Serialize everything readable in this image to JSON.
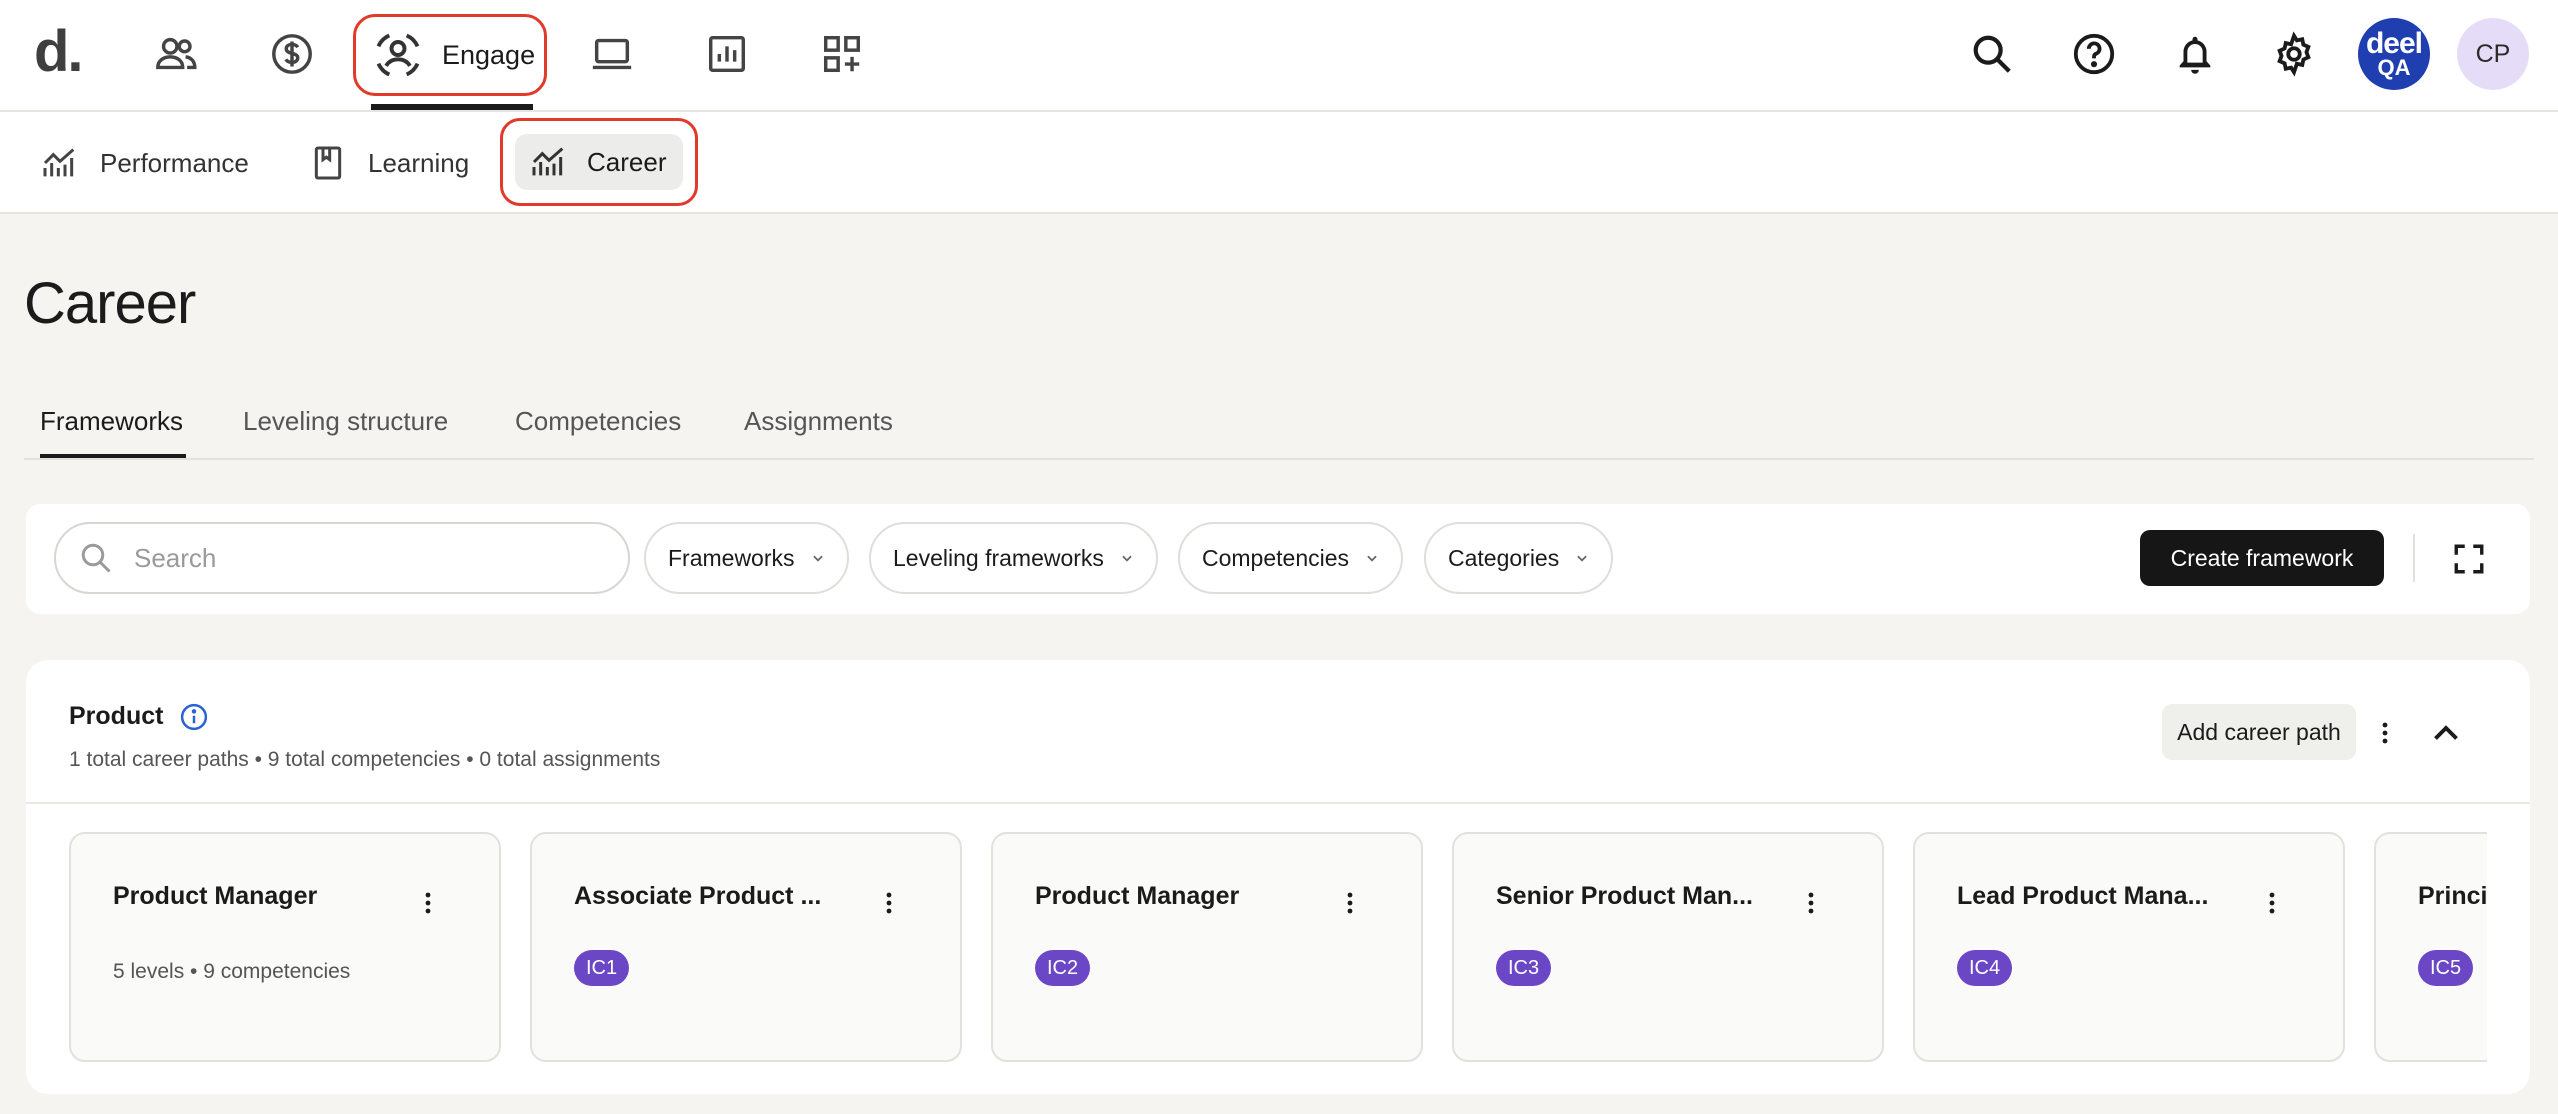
{
  "topnav": {
    "logo": "d.",
    "engage_label": "Engage",
    "avatar_deel": {
      "line1": "deel",
      "line2": "QA"
    },
    "avatar_initials": "CP"
  },
  "subnav": {
    "performance": "Performance",
    "learning": "Learning",
    "career": "Career"
  },
  "page": {
    "title": "Career",
    "tabs": [
      "Frameworks",
      "Leveling structure",
      "Competencies",
      "Assignments"
    ]
  },
  "filters": {
    "search_placeholder": "Search",
    "frameworks": "Frameworks",
    "leveling": "Leveling frameworks",
    "competencies": "Competencies",
    "categories": "Categories",
    "create_button": "Create framework"
  },
  "section": {
    "title": "Product",
    "meta": "1 total career paths • 9 total competencies • 0 total assignments",
    "add_button": "Add career path",
    "cards": [
      {
        "title": "Product Manager",
        "meta": "5 levels • 9 competencies"
      },
      {
        "title": "Associate Product ...",
        "badge": "IC1"
      },
      {
        "title": "Product Manager",
        "badge": "IC2"
      },
      {
        "title": "Senior Product Man...",
        "badge": "IC3"
      },
      {
        "title": "Lead Product Mana...",
        "badge": "IC4"
      },
      {
        "title": "Princi",
        "badge": "IC5"
      }
    ]
  },
  "colors": {
    "accent_outline": "#e23a2a",
    "badge": "#6b47c6",
    "primary_button": "#161616"
  }
}
